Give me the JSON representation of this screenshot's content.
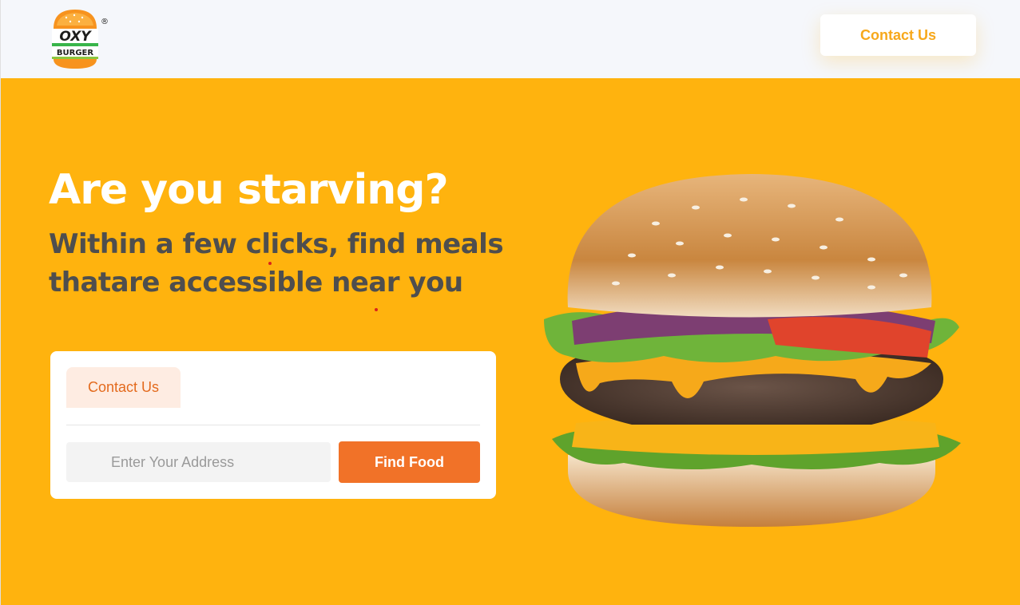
{
  "header": {
    "logo": {
      "line1": "OXY",
      "line2": "BURGER",
      "registered": "®"
    },
    "contact_label": "Contact Us"
  },
  "hero": {
    "headline": "Are you starving?",
    "subline": "Within a few clicks, find meals thatare accessible near you"
  },
  "search_card": {
    "tab_label": "Contact Us",
    "address_placeholder": "Enter Your Address",
    "find_label": "Find Food"
  },
  "colors": {
    "background": "#ffb30e",
    "header_bg": "#f5f7fb",
    "accent_orange": "#f17228",
    "tab_bg": "#feece2",
    "contact_text": "#f7a81b",
    "subline_text": "#4e4e4e"
  }
}
